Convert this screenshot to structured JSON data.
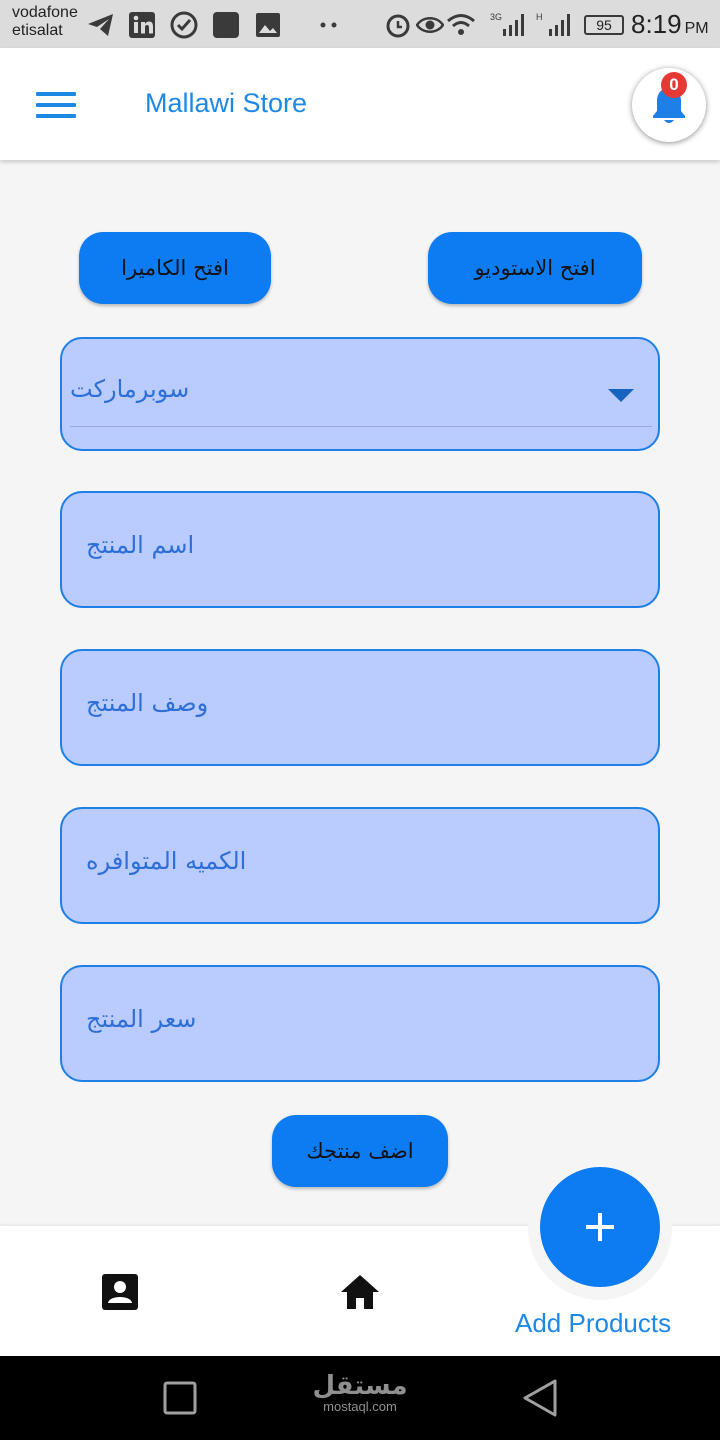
{
  "status_bar": {
    "carrier_line1": "vodafone",
    "carrier_line2": "etisalat",
    "network_3g": "3G",
    "network_h": "H",
    "battery": "95",
    "time": "8:19",
    "ampm": "PM",
    "icons": [
      "telegram-icon",
      "linkedin-icon",
      "check-icon",
      "app-icon",
      "gallery-icon",
      "dots-icon",
      "alarm-icon",
      "eye-icon",
      "wifi-icon",
      "signal-icon",
      "signal-icon",
      "battery-icon"
    ]
  },
  "app_bar": {
    "title": "Mallawi Store",
    "notification_count": "0"
  },
  "buttons": {
    "open_camera": "افتح الكاميرا",
    "open_studio": "افتح الاستوديو",
    "add_product": "اضف منتجك"
  },
  "category_dropdown": {
    "selected": "سوبرماركت"
  },
  "form": {
    "product_name": "اسم المنتج",
    "product_description": "وصف المنتج",
    "available_quantity": "الكميه المتوافره",
    "product_price": "سعر المنتج"
  },
  "bottom_nav": {
    "items": [
      "profile-icon",
      "home-icon"
    ],
    "fab_label": "Add Products"
  },
  "watermark": {
    "logo": "مستقل",
    "domain": "mostaql.com"
  },
  "colors": {
    "primary": "#0d7cf2",
    "accent_text": "#1e88e5",
    "field_fill": "#bacbfd",
    "badge": "#e53935"
  }
}
